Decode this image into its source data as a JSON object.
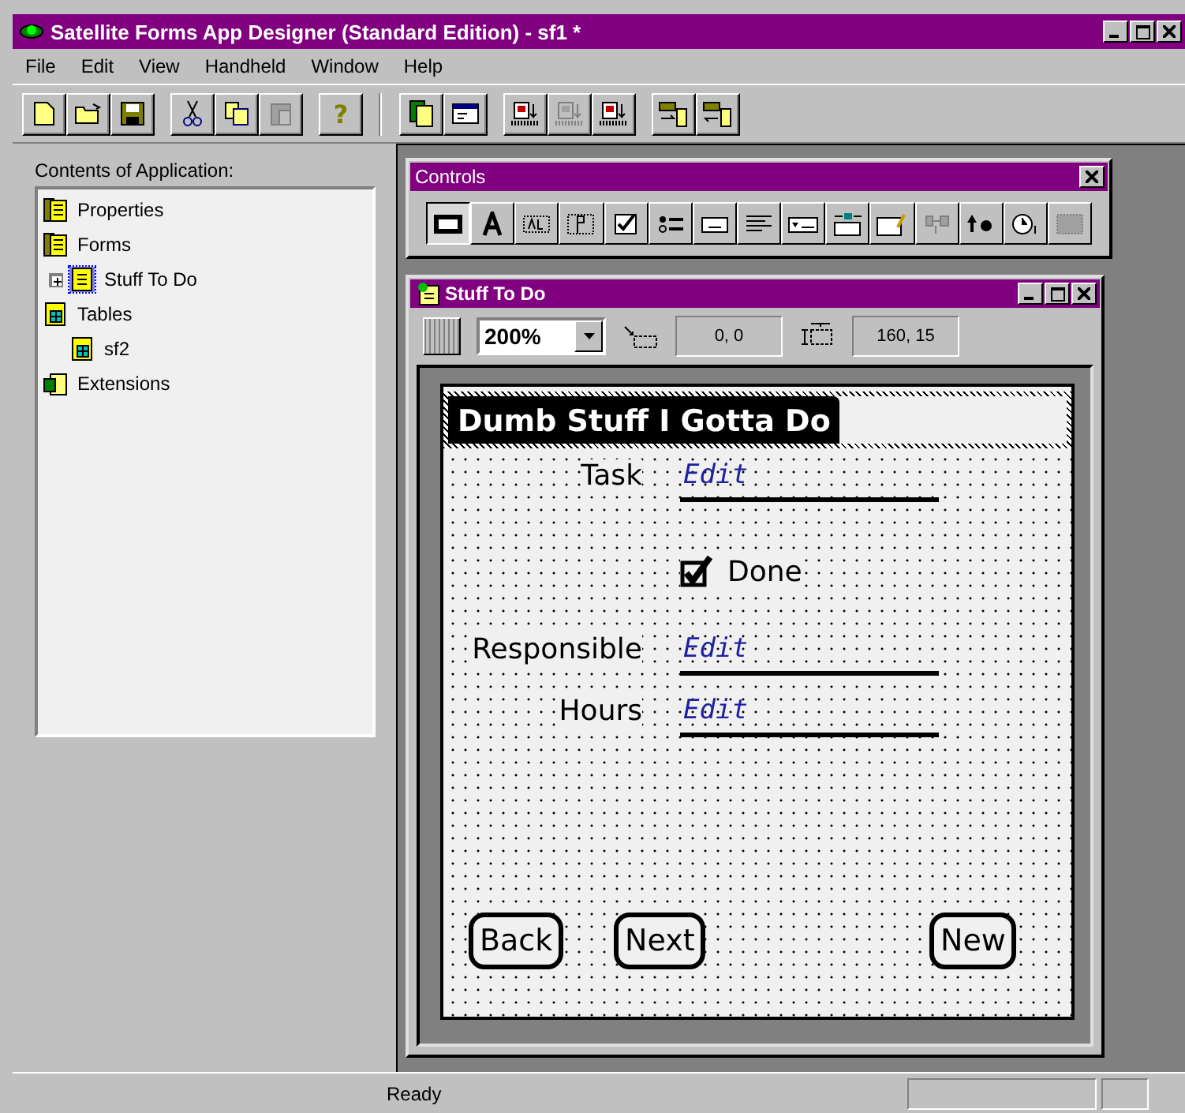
{
  "window": {
    "title": "Satellite Forms App Designer (Standard Edition) - sf1 *"
  },
  "menu": [
    "File",
    "Edit",
    "View",
    "Handheld",
    "Window",
    "Help"
  ],
  "toolbar": [
    [
      {
        "kind": "new",
        "disabled": false
      },
      {
        "kind": "open",
        "disabled": false
      },
      {
        "kind": "save",
        "disabled": false
      }
    ],
    [
      {
        "kind": "cut",
        "disabled": false
      },
      {
        "kind": "copy",
        "disabled": false
      },
      {
        "kind": "paste",
        "disabled": true
      }
    ],
    [
      {
        "kind": "help",
        "disabled": false,
        "label": "?"
      }
    ],
    [
      {
        "kind": "app",
        "disabled": false
      },
      {
        "kind": "form",
        "disabled": false
      }
    ],
    [
      {
        "kind": "download",
        "disabled": false
      },
      {
        "kind": "download",
        "disabled": true
      },
      {
        "kind": "download",
        "disabled": false
      }
    ],
    [
      {
        "kind": "send",
        "disabled": false
      },
      {
        "kind": "receive",
        "disabled": false
      }
    ]
  ],
  "sidebar": {
    "title": "Contents of Application:",
    "items": [
      {
        "label": "Properties",
        "kind": "props"
      },
      {
        "label": "Forms",
        "kind": "props",
        "children": [
          {
            "label": "Stuff To Do",
            "kind": "form",
            "selected": true,
            "expanded": false
          }
        ]
      },
      {
        "label": "Tables",
        "kind": "table",
        "children": [
          {
            "label": "sf2",
            "kind": "table",
            "selected": false
          }
        ]
      },
      {
        "label": "Extensions",
        "kind": "ext"
      }
    ]
  },
  "controls_palette": {
    "title": "Controls",
    "tools": [
      {
        "kind": "label",
        "selected": true,
        "disabled": false
      },
      {
        "kind": "text",
        "selected": false,
        "disabled": false
      },
      {
        "kind": "field",
        "selected": false,
        "disabled": false
      },
      {
        "kind": "paste",
        "selected": false,
        "disabled": false
      },
      {
        "kind": "check",
        "selected": false,
        "disabled": false
      },
      {
        "kind": "radio",
        "selected": false,
        "disabled": false
      },
      {
        "kind": "button",
        "selected": false,
        "disabled": false
      },
      {
        "kind": "list",
        "selected": false,
        "disabled": false
      },
      {
        "kind": "combo",
        "selected": false,
        "disabled": false
      },
      {
        "kind": "lookup",
        "selected": false,
        "disabled": false
      },
      {
        "kind": "ink",
        "selected": false,
        "disabled": false
      },
      {
        "kind": "graffiti",
        "selected": false,
        "disabled": true
      },
      {
        "kind": "bitmap",
        "selected": false,
        "disabled": false
      },
      {
        "kind": "clock",
        "selected": false,
        "disabled": false
      },
      {
        "kind": "grid",
        "selected": false,
        "disabled": true
      }
    ]
  },
  "form_window": {
    "title": "Stuff To Do",
    "zoom": "200%",
    "position": "0, 0",
    "size": "160, 15",
    "form": {
      "title": "Dumb Stuff I Gotta Do",
      "controls": [
        {
          "kind": "edit",
          "label": "Task",
          "text": "Edit"
        },
        {
          "kind": "checkbox",
          "label": "Done",
          "checked": true
        },
        {
          "kind": "edit",
          "label": "Responsible",
          "text": "Edit"
        },
        {
          "kind": "edit",
          "label": "Hours",
          "text": "Edit"
        }
      ],
      "buttons": [
        "Back",
        "Next",
        "New"
      ]
    }
  },
  "status_bar": {
    "text": "Ready"
  }
}
